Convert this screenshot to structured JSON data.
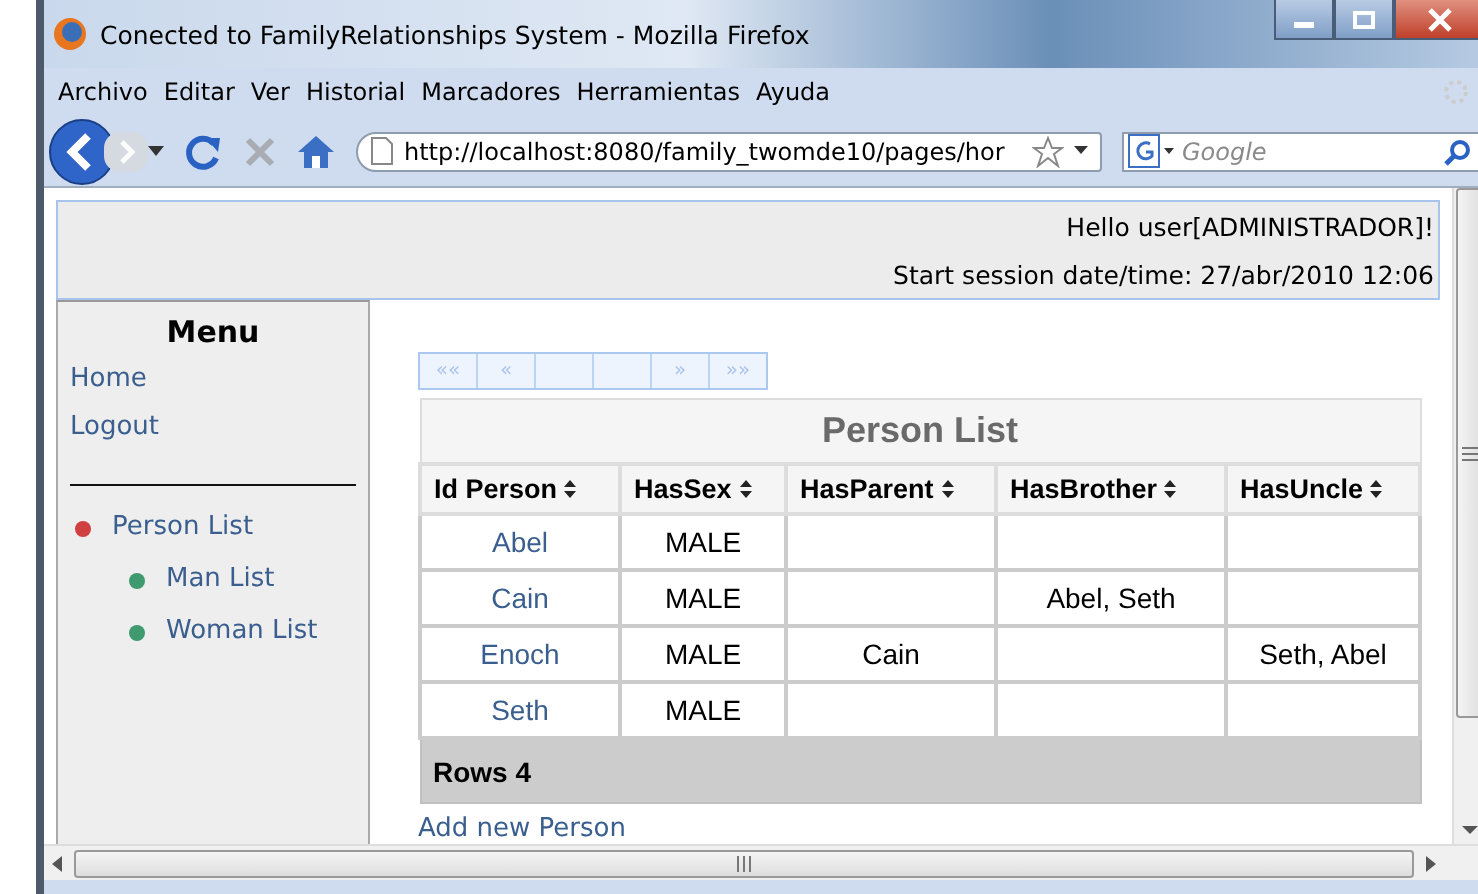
{
  "window": {
    "title": "Conected to FamilyRelationships System - Mozilla Firefox"
  },
  "menu_bar": [
    "Archivo",
    "Editar",
    "Ver",
    "Historial",
    "Marcadores",
    "Herramientas",
    "Ayuda"
  ],
  "address_bar": {
    "url": "http://localhost:8080/family_twomde10/pages/hor"
  },
  "search": {
    "placeholder": "Google"
  },
  "header": {
    "greeting": "Hello user[ADMINISTRADOR]!",
    "session": "Start session date/time: 27/abr/2010 12:06"
  },
  "sidebar": {
    "title": "Menu",
    "links": [
      "Home",
      "Logout"
    ],
    "tree": [
      {
        "label": "Person List",
        "children": [
          {
            "label": "Man List"
          },
          {
            "label": "Woman List"
          }
        ]
      }
    ]
  },
  "pager": {
    "first": "««",
    "previous": "«",
    "next": "»",
    "last": "»»"
  },
  "table": {
    "title": "Person List",
    "columns": [
      "Id Person",
      "HasSex",
      "HasParent",
      "HasBrother",
      "HasUncle"
    ],
    "rows": [
      {
        "id_person": "Abel",
        "has_sex": "MALE"
      },
      {
        "id_person": "Cain",
        "has_sex": "MALE",
        "has_brother": "Abel, Seth"
      },
      {
        "id_person": "Enoch",
        "has_sex": "MALE",
        "has_parent": "Cain",
        "has_uncle": "Seth, Abel"
      },
      {
        "id_person": "Seth",
        "has_sex": "MALE"
      }
    ],
    "footer": "Rows 4"
  },
  "add_link": "Add new Person"
}
